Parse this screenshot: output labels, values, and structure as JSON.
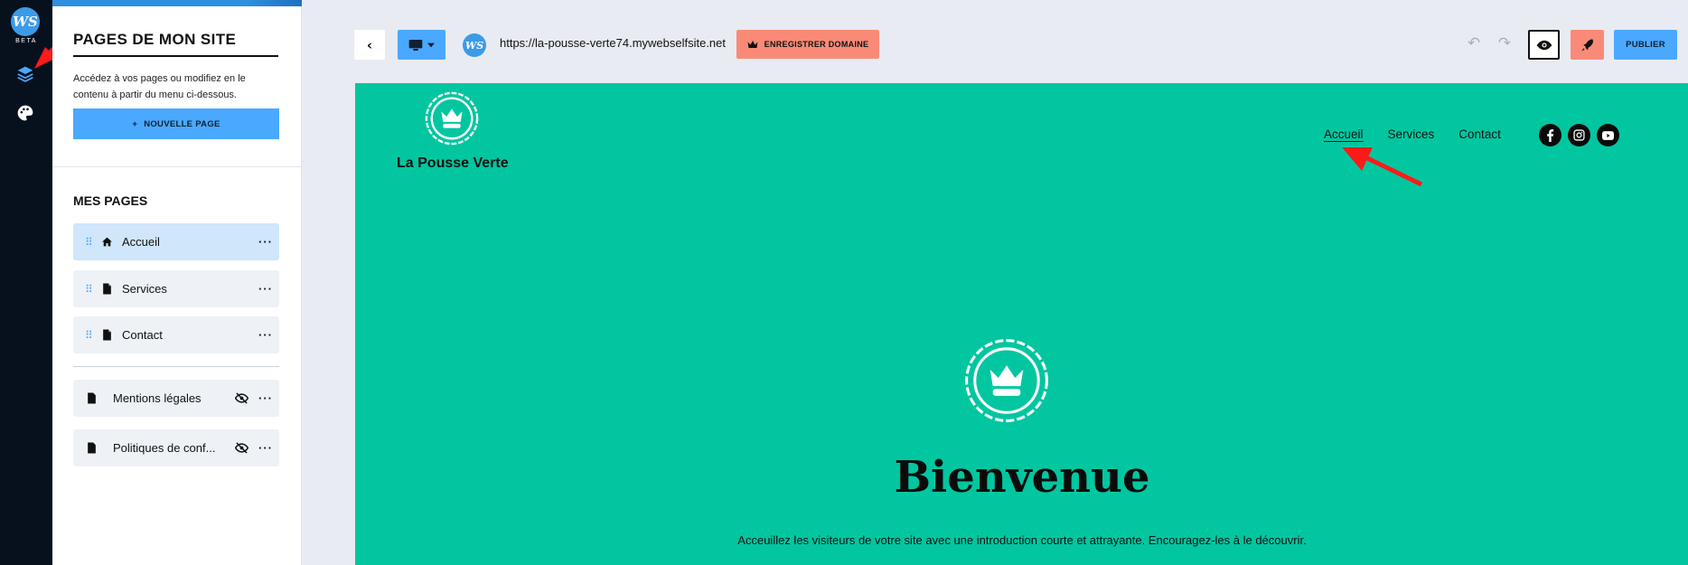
{
  "rail": {
    "logo_text": "WS",
    "beta_label": "BETA",
    "items": [
      {
        "icon": "layers-icon",
        "active": true
      },
      {
        "icon": "palette-icon",
        "active": false
      }
    ]
  },
  "panel": {
    "title": "PAGES DE MON SITE",
    "description": "Accédez à vos pages ou modifiez en le contenu à partir du menu ci-dessous.",
    "new_page_button": "NOUVELLE PAGE",
    "section_title": "MES PAGES",
    "pages": [
      {
        "label": "Accueil",
        "icon": "home-icon",
        "active": true
      },
      {
        "label": "Services",
        "icon": "document-icon",
        "active": false
      },
      {
        "label": "Contact",
        "icon": "document-icon",
        "active": false
      }
    ],
    "hidden_pages": [
      {
        "label": "Mentions légales",
        "icon": "document-icon",
        "hidden": true
      },
      {
        "label": "Politiques de conf...",
        "icon": "document-icon",
        "hidden": true
      }
    ]
  },
  "toolbar": {
    "back_icon": "chevron-left-icon",
    "device_icon": "desktop-icon",
    "site_logo_text": "WS",
    "url": "https://la-pousse-verte74.mywebselfsite.net",
    "domain_button": "ENREGISTRER DOMAINE",
    "publish_button": "PUBLIER"
  },
  "site": {
    "name": "La Pousse Verte",
    "nav": [
      "Accueil",
      "Services",
      "Contact"
    ],
    "active_nav": "Accueil",
    "social": [
      "facebook-icon",
      "instagram-icon",
      "youtube-icon"
    ],
    "hero_title": "Bienvenue",
    "hero_subtitle": "Acceuillez les visiteurs de votre site avec une introduction courte et attrayante. Encouragez-les à le découvrir.",
    "background_color": "#02c6a0"
  },
  "colors": {
    "accent_blue": "#4aa8ff",
    "accent_coral": "#f98a78",
    "rail_bg": "#07111e",
    "annotation_arrow": "#ff1a1a"
  }
}
